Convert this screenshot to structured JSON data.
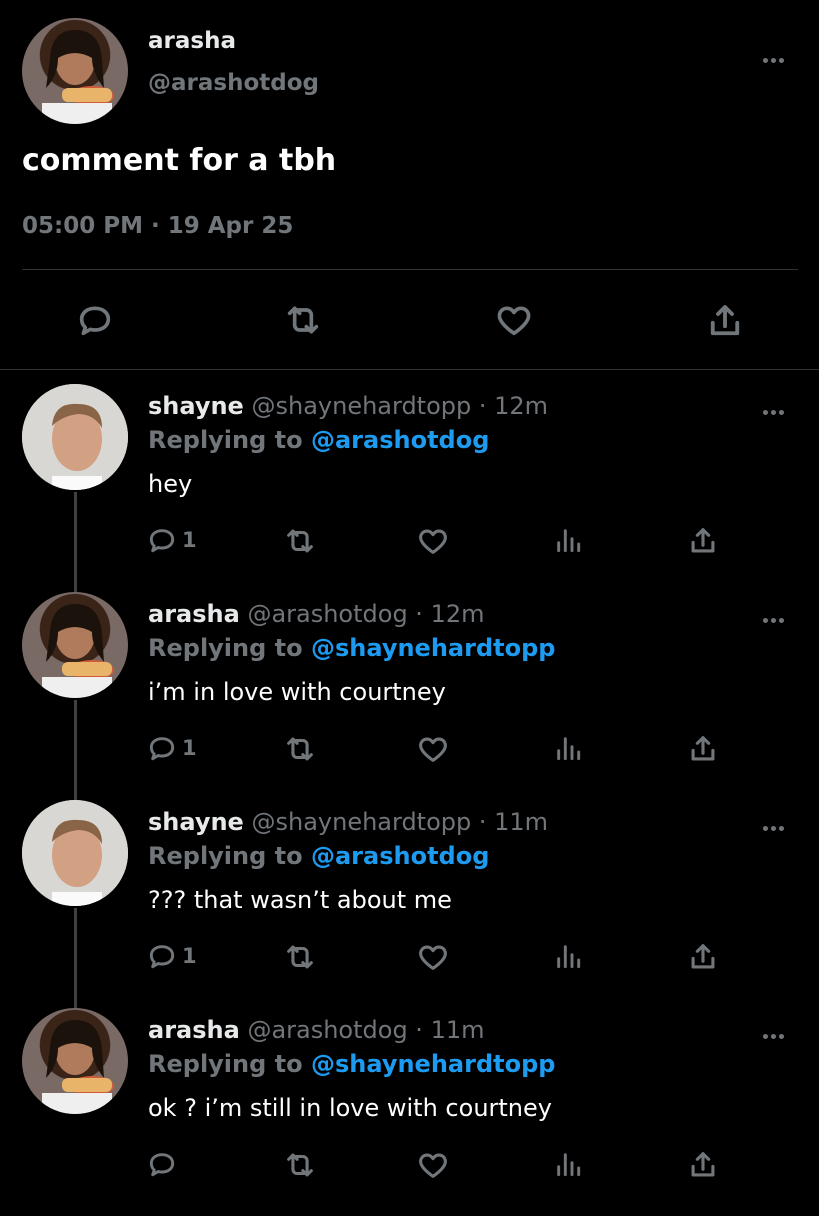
{
  "main_tweet": {
    "author_name": "arasha",
    "author_handle": "@arashotdog",
    "text": "comment for a tbh",
    "timestamp": "05:00 PM · 19 Apr 25",
    "actions": [
      "reply-icon",
      "retweet-icon",
      "like-icon",
      "share-icon"
    ]
  },
  "replies": [
    {
      "name": "shayne",
      "handle": "@shaynehardtopp · 12m",
      "replying_label": "Replying to",
      "replying_to": "@arashotdog",
      "text": "hey",
      "reply_count": "1"
    },
    {
      "name": "arasha",
      "handle": "@arashotdog · 12m",
      "replying_label": "Replying to",
      "replying_to": "@shaynehardtopp",
      "text": "i’m in love with courtney",
      "reply_count": "1"
    },
    {
      "name": "shayne",
      "handle": "@shaynehardtopp · 11m",
      "replying_label": "Replying to",
      "replying_to": "@arashotdog",
      "text": "??? that wasn’t about me",
      "reply_count": "1"
    },
    {
      "name": "arasha",
      "handle": "@arashotdog · 11m",
      "replying_label": "Replying to",
      "replying_to": "@shaynehardtopp",
      "text": "ok ? i’m still in love with courtney",
      "reply_count": ""
    }
  ],
  "colors": {
    "background": "#000000",
    "text": "#e7e9ea",
    "secondary": "#71767b",
    "accent": "#1d9bf0"
  }
}
